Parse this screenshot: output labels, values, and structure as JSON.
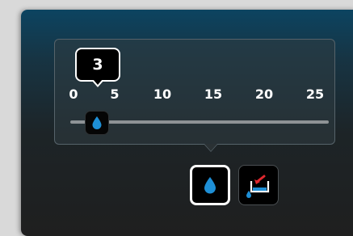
{
  "slider": {
    "value": "3",
    "min": 0,
    "max": 25,
    "current": 3,
    "tick_labels": [
      "0",
      "5",
      "10",
      "15",
      "20",
      "25"
    ],
    "thumb_icon": "water-drop-icon"
  },
  "modes": [
    {
      "name": "water-drop",
      "icon": "water-drop-icon",
      "selected": true
    },
    {
      "name": "fill-bucket",
      "icon": "fill-container-icon",
      "selected": false
    }
  ],
  "colors": {
    "accent_blue": "#1e8fd6",
    "arrow_red": "#e0282e",
    "panel_top": "#0c4461"
  }
}
